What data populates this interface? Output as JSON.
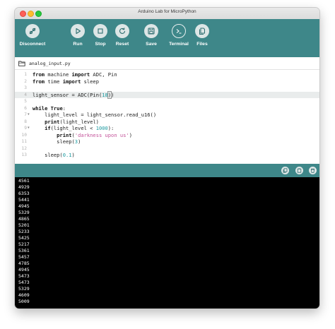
{
  "window": {
    "title": "Arduino Lab for MicroPython"
  },
  "toolbar": {
    "buttons": [
      {
        "label": "Disconnect",
        "icon": "disconnect-icon"
      },
      {
        "label": "Run",
        "icon": "play-icon"
      },
      {
        "label": "Stop",
        "icon": "stop-icon"
      },
      {
        "label": "Reset",
        "icon": "reset-icon"
      },
      {
        "label": "Save",
        "icon": "save-icon"
      },
      {
        "label": "Terminal",
        "icon": "terminal-icon"
      },
      {
        "label": "Files",
        "icon": "files-icon"
      }
    ],
    "active": "Terminal"
  },
  "tab": {
    "filename": "analog_input.py",
    "icon": "folder-icon"
  },
  "editor": {
    "active_line": 4,
    "lines": [
      {
        "n": "1",
        "fold": false
      },
      {
        "n": "2",
        "fold": false
      },
      {
        "n": "3",
        "fold": false
      },
      {
        "n": "4",
        "fold": false
      },
      {
        "n": "5",
        "fold": false
      },
      {
        "n": "6",
        "fold": false
      },
      {
        "n": "7",
        "fold": true
      },
      {
        "n": "8",
        "fold": false
      },
      {
        "n": "9",
        "fold": true
      },
      {
        "n": "10",
        "fold": false
      },
      {
        "n": "11",
        "fold": false
      },
      {
        "n": "12",
        "fold": false
      },
      {
        "n": "13",
        "fold": false
      }
    ],
    "tokens": {
      "l1_kw1": "from",
      "l1_mid": " machine ",
      "l1_kw2": "import",
      "l1_rest": " ADC, Pin",
      "l2_kw1": "from",
      "l2_mid": " time ",
      "l2_kw2": "import",
      "l2_rest": " sleep",
      "l4_a": "light_sensor = ADC",
      "l4_b": "(",
      "l4_c": "Pin(",
      "l4_num": "18",
      "l4_d": ")",
      "l4_e": ")",
      "l6_kw": "while",
      "l6_sp": " ",
      "l6_kw2": "True",
      "l6_rest": ":",
      "l7": "    light_level = light_sensor.read_u16()",
      "l8_kw": "    print",
      "l8_rest": "(light_level)",
      "l9_kw": "    if",
      "l9_a": "(light_level < ",
      "l9_num": "1000",
      "l9_b": "):",
      "l10_kw": "        print",
      "l10_a": "(",
      "l10_str": "'darkness upon us'",
      "l10_b": ")",
      "l11_a": "        sleep(",
      "l11_num": "3",
      "l11_b": ")",
      "l13_a": "    sleep(",
      "l13_num": "0.1",
      "l13_b": ")"
    }
  },
  "terminal_bar": {
    "buttons": [
      {
        "icon": "copy-icon"
      },
      {
        "icon": "paste-icon"
      },
      {
        "icon": "trash-icon"
      }
    ]
  },
  "terminal": {
    "lines": [
      "4561",
      "4929",
      "6353",
      "5441",
      "4945",
      "5329",
      "4865",
      "5201",
      "5233",
      "5425",
      "5217",
      "5361",
      "5457",
      "4785",
      "4945",
      "5473",
      "5473",
      "5329",
      "4609",
      "5009"
    ]
  },
  "colors": {
    "toolbar": "#3e8789",
    "terminal_bg": "#000000",
    "number": "#1b9aa0",
    "string": "#c4539a"
  }
}
